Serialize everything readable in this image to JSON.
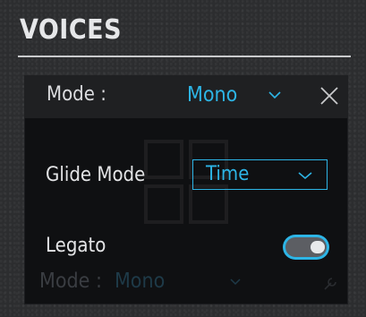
{
  "section": {
    "title": "VOICES"
  },
  "panel": {
    "header": {
      "mode_label": "Mode :",
      "mode_value": "Mono",
      "chevron_icon": "chevron-down-icon",
      "close_icon": "close-icon"
    },
    "glide": {
      "label": "Glide Mode",
      "value": "Time"
    },
    "legato": {
      "label": "Legato",
      "enabled": true
    },
    "ghost": {
      "mode_label": "Mode :",
      "mode_value": "Mono"
    }
  },
  "colors": {
    "accent": "#2db5e6",
    "panel_bg": "#0f1012",
    "header_bg": "#1f2022",
    "page_bg": "#2c2d2f"
  }
}
